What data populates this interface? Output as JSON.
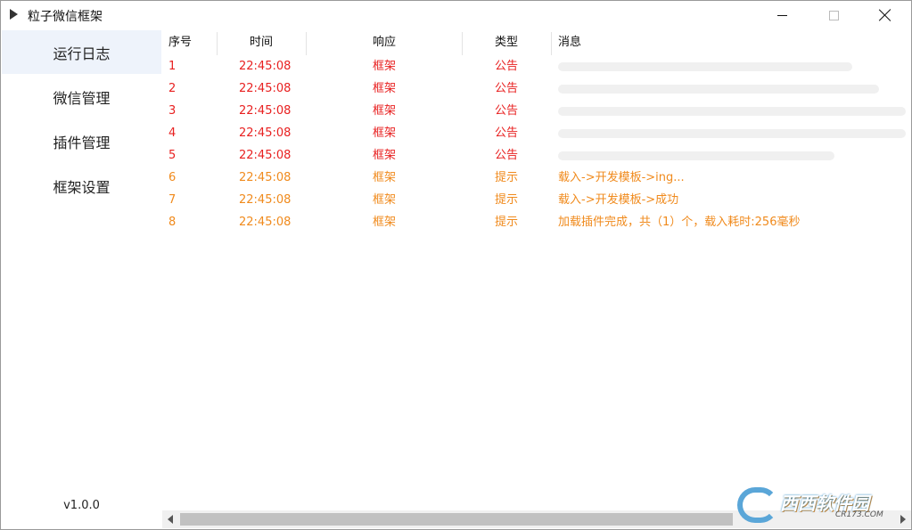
{
  "window": {
    "title": "粒子微信框架",
    "controls": {
      "minimize": "minimize-icon",
      "maximize": "maximize-icon",
      "close": "close-icon"
    }
  },
  "sidebar": {
    "items": [
      {
        "label": "运行日志",
        "active": true
      },
      {
        "label": "微信管理",
        "active": false
      },
      {
        "label": "插件管理",
        "active": false
      },
      {
        "label": "框架设置",
        "active": false
      }
    ],
    "version": "v1.0.0"
  },
  "table": {
    "headers": {
      "no": "序号",
      "time": "时间",
      "response": "响应",
      "type": "类型",
      "message": "消息"
    },
    "rows": [
      {
        "no": "1",
        "time": "22:45:08",
        "response": "框架",
        "type": "公告",
        "message": "",
        "color": "#e82020"
      },
      {
        "no": "2",
        "time": "22:45:08",
        "response": "框架",
        "type": "公告",
        "message": "",
        "color": "#e82020"
      },
      {
        "no": "3",
        "time": "22:45:08",
        "response": "框架",
        "type": "公告",
        "message": "",
        "color": "#e82020"
      },
      {
        "no": "4",
        "time": "22:45:08",
        "response": "框架",
        "type": "公告",
        "message": "",
        "color": "#e82020"
      },
      {
        "no": "5",
        "time": "22:45:08",
        "response": "框架",
        "type": "公告",
        "message": "",
        "color": "#e82020"
      },
      {
        "no": "6",
        "time": "22:45:08",
        "response": "框架",
        "type": "提示",
        "message": "载入->开发模板->ing...",
        "color": "#f08a1c"
      },
      {
        "no": "7",
        "time": "22:45:08",
        "response": "框架",
        "type": "提示",
        "message": "载入->开发模板->成功",
        "color": "#f08a1c"
      },
      {
        "no": "8",
        "time": "22:45:08",
        "response": "框架",
        "type": "提示",
        "message": "加载插件完成，共（1）个，载入耗时:256毫秒",
        "color": "#f08a1c"
      }
    ]
  },
  "watermark": {
    "main": "西西软件园",
    "sub": "CR173.COM"
  },
  "colors": {
    "notice": "#e82020",
    "hint": "#f08a1c",
    "active_nav": "#eef3fb"
  }
}
